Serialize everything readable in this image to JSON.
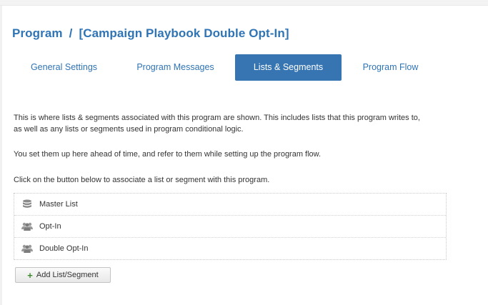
{
  "breadcrumb": {
    "root": "Program",
    "separator": "/",
    "current": "[Campaign Playbook Double Opt-In]"
  },
  "tabs": [
    {
      "label": "General Settings",
      "active": false
    },
    {
      "label": "Program Messages",
      "active": false
    },
    {
      "label": "Lists & Segments",
      "active": true
    },
    {
      "label": "Program Flow",
      "active": false
    }
  ],
  "description": {
    "line1": "This is where lists & segments associated with this program are shown. This includes lists that this program writes to,",
    "line2": "as well as any lists or segments used in program conditional logic.",
    "line3": "You set them up here ahead of time, and refer to them while setting up the program flow.",
    "line4": "Click on the button below to associate a list or segment with this program."
  },
  "lists": [
    {
      "name": "Master List",
      "icon": "database-icon"
    },
    {
      "name": "Opt-In",
      "icon": "users-icon"
    },
    {
      "name": "Double Opt-In",
      "icon": "users-icon"
    }
  ],
  "add_button": {
    "label": "Add List/Segment",
    "icon": "plus-icon"
  },
  "colors": {
    "accent": "#2f74b5",
    "active_tab": "#3675b2",
    "plus": "#3c8a2e"
  }
}
